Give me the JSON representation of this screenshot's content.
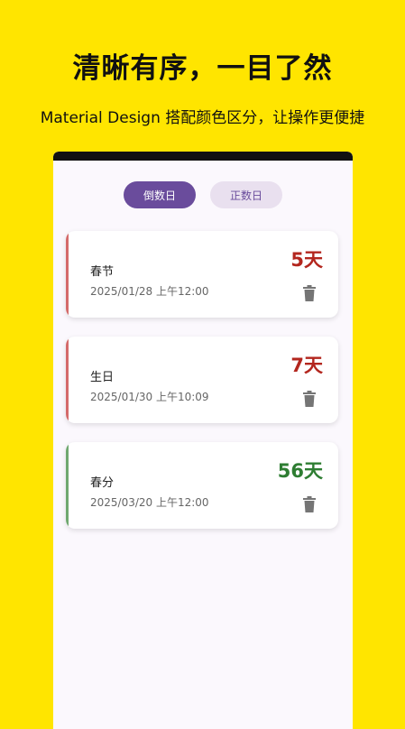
{
  "promo": {
    "headline": "清晰有序，一目了然",
    "subline": "Material Design 搭配颜色区分，让操作更便捷"
  },
  "tabs": [
    {
      "label": "倒数日",
      "active": true
    },
    {
      "label": "正数日",
      "active": false
    }
  ],
  "events": [
    {
      "name": "春节",
      "date": "2025/01/28 上午12:00",
      "days": "5天",
      "color": "#B3261E",
      "accent": "#D46A6A"
    },
    {
      "name": "生日",
      "date": "2025/01/30 上午10:09",
      "days": "7天",
      "color": "#B3261E",
      "accent": "#D46A6A"
    },
    {
      "name": "春分",
      "date": "2025/03/20 上午12:00",
      "days": "56天",
      "color": "#2E7D32",
      "accent": "#6FA86F"
    }
  ],
  "icons": {
    "delete": "trash-icon"
  }
}
